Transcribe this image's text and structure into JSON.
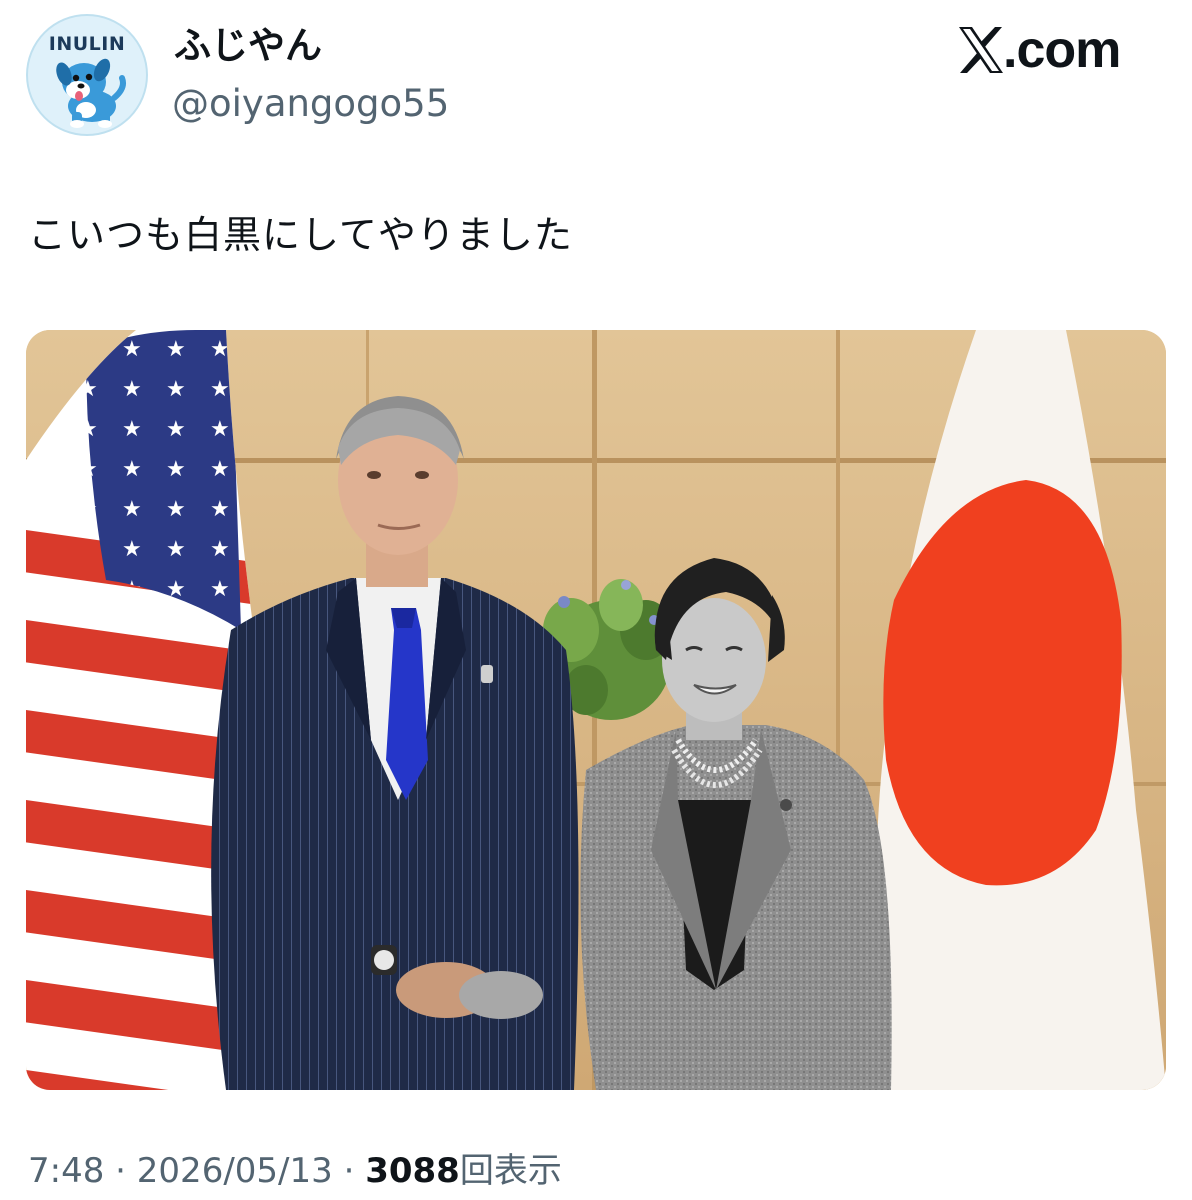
{
  "author": {
    "display_name": "ふじやん",
    "handle": "@oiyangogo55",
    "avatar_text": "INULIN",
    "avatar_icon": "dog-mascot-icon"
  },
  "brand": {
    "domain": ".com",
    "logo_icon": "x-logo-icon"
  },
  "post": {
    "text": "こいつも白黒にしてやりました",
    "media_icon": "handshake-photo"
  },
  "meta": {
    "time": "7:48",
    "separator_1": " · ",
    "date": "2026/05/13",
    "separator_2": " · ",
    "views_count": "3088",
    "views_label": "回表示"
  },
  "colors": {
    "text_primary": "#0f1419",
    "text_secondary": "#536471",
    "flag_red": "#d93a2b",
    "flag_blue": "#2c3a85",
    "wall": "#d8b987"
  }
}
